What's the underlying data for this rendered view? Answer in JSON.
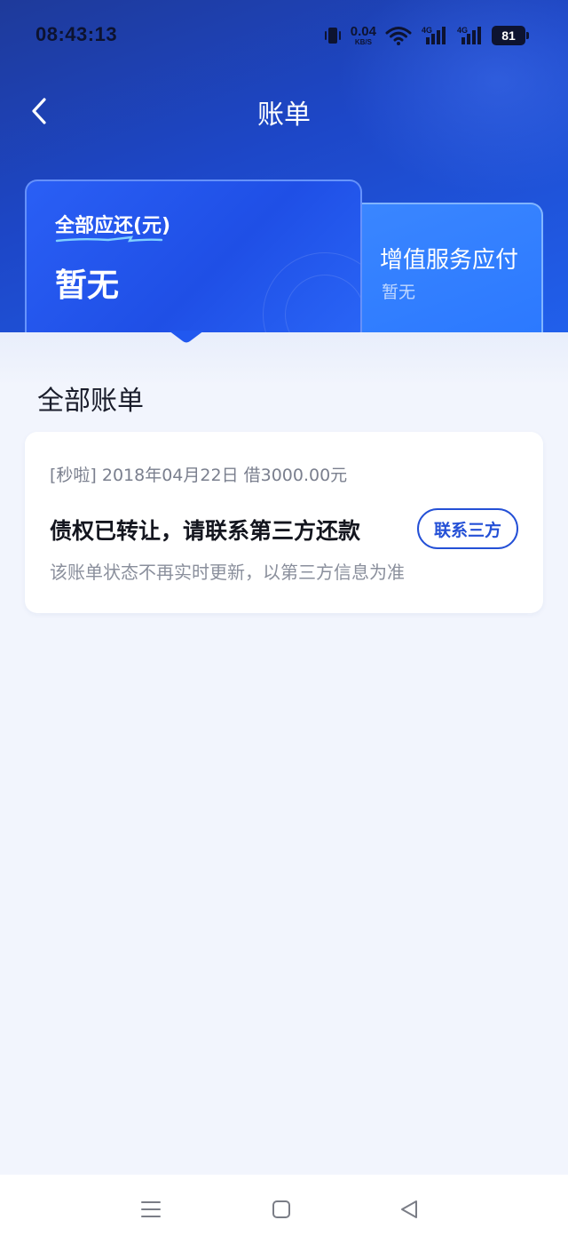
{
  "status_bar": {
    "time": "08:43:13",
    "net_speed_value": "0.04",
    "net_speed_unit": "KB/S",
    "battery_level": "81",
    "icons": [
      "vibrate-icon",
      "wifi-icon",
      "signal-4g-icon",
      "signal-4g-icon",
      "battery-icon"
    ]
  },
  "header": {
    "title": "账单",
    "back_icon": "chevron-left-icon"
  },
  "summary": {
    "main_label": "全部应还(元)",
    "main_value": "暂无",
    "side_label": "增值服务应付",
    "side_value": "暂无"
  },
  "section": {
    "title": "全部账单"
  },
  "bill": {
    "meta": "[秒啦] 2018年04月22日 借3000.00元",
    "status": "债权已转让，请联系第三方还款",
    "note": "该账单状态不再实时更新，以第三方信息为准",
    "action_label": "联系三方"
  },
  "system_nav": {
    "icons": [
      "menu-icon",
      "home-icon",
      "back-triangle-icon"
    ]
  },
  "colors": {
    "header_blue": "#1d47c8",
    "accent_blue": "#2450d6",
    "page_bg": "#f2f5fd"
  }
}
